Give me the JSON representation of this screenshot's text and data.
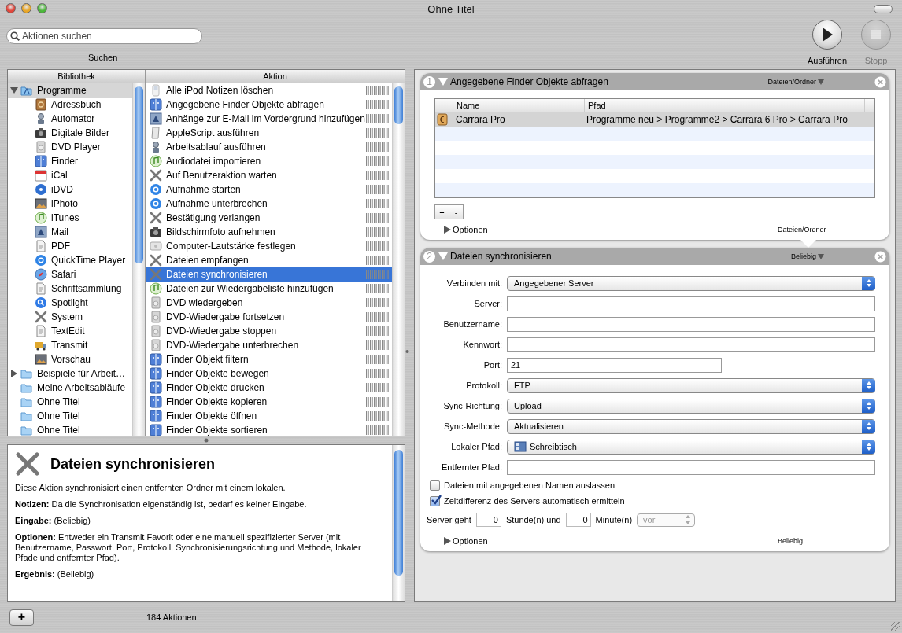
{
  "window": {
    "title": "Ohne Titel"
  },
  "toolbar": {
    "search": {
      "placeholder": "Aktionen suchen"
    },
    "search_label": "Suchen",
    "run": {
      "label": "Ausführen",
      "disabled": false
    },
    "stop": {
      "label": "Stopp",
      "disabled": true
    }
  },
  "library": {
    "header": "Bibliothek",
    "items": [
      {
        "label": "Programme",
        "kind": "apps",
        "selected": true,
        "expanded": true,
        "children": [
          {
            "label": "Adressbuch",
            "kind": "book",
            "selected": false
          },
          {
            "label": "Automator",
            "kind": "robot",
            "selected": false
          },
          {
            "label": "Digitale Bilder",
            "kind": "camera",
            "selected": false
          },
          {
            "label": "DVD Player",
            "kind": "dvd",
            "selected": false
          },
          {
            "label": "Finder",
            "kind": "finder",
            "selected": false
          },
          {
            "label": "iCal",
            "kind": "calendar",
            "selected": false
          },
          {
            "label": "iDVD",
            "kind": "disc",
            "selected": false
          },
          {
            "label": "iPhoto",
            "kind": "photo",
            "selected": false
          },
          {
            "label": "iTunes",
            "kind": "music",
            "selected": false
          },
          {
            "label": "Mail",
            "kind": "mail",
            "selected": false
          },
          {
            "label": "PDF",
            "kind": "document",
            "selected": false
          },
          {
            "label": "QuickTime Player",
            "kind": "quicktime",
            "selected": false
          },
          {
            "label": "Safari",
            "kind": "compass",
            "selected": false
          },
          {
            "label": "Schriftsammlung",
            "kind": "document",
            "selected": false
          },
          {
            "label": "Spotlight",
            "kind": "search",
            "selected": false
          },
          {
            "label": "System",
            "kind": "tools",
            "selected": false
          },
          {
            "label": "TextEdit",
            "kind": "document",
            "selected": false
          },
          {
            "label": "Transmit",
            "kind": "truck",
            "selected": false
          },
          {
            "label": "Vorschau",
            "kind": "photo",
            "selected": false
          }
        ]
      },
      {
        "label": "Beispiele für Arbeit…",
        "kind": "folder",
        "selected": false,
        "expanded": false
      },
      {
        "label": "Meine Arbeitsabläufe",
        "kind": "folder",
        "selected": false
      },
      {
        "label": "Ohne Titel",
        "kind": "folder",
        "selected": false
      },
      {
        "label": "Ohne Titel",
        "kind": "folder",
        "selected": false
      },
      {
        "label": "Ohne Titel",
        "kind": "folder",
        "selected": false
      }
    ]
  },
  "actions": {
    "header": "Aktion",
    "items": [
      {
        "label": "Alle iPod Notizen löschen",
        "kind": "ipod",
        "selected": false
      },
      {
        "label": "Angegebene Finder Objekte abfragen",
        "kind": "finder",
        "selected": false
      },
      {
        "label": "Anhänge zur E-Mail im Vordergrund hinzufügen",
        "kind": "mail",
        "selected": false
      },
      {
        "label": "AppleScript ausführen",
        "kind": "script",
        "selected": false
      },
      {
        "label": "Arbeitsablauf ausführen",
        "kind": "robot",
        "selected": false
      },
      {
        "label": "Audiodatei importieren",
        "kind": "music",
        "selected": false
      },
      {
        "label": "Auf Benutzeraktion warten",
        "kind": "tools",
        "selected": false
      },
      {
        "label": "Aufnahme starten",
        "kind": "quicktime",
        "selected": false
      },
      {
        "label": "Aufnahme unterbrechen",
        "kind": "quicktime",
        "selected": false
      },
      {
        "label": "Bestätigung verlangen",
        "kind": "tools",
        "selected": false
      },
      {
        "label": "Bildschirmfoto aufnehmen",
        "kind": "camera",
        "selected": false
      },
      {
        "label": "Computer-Lautstärke festlegen",
        "kind": "speaker",
        "selected": false
      },
      {
        "label": "Dateien empfangen",
        "kind": "tools",
        "selected": false
      },
      {
        "label": "Dateien synchronisieren",
        "kind": "tools",
        "selected": true
      },
      {
        "label": "Dateien zur Wiedergabeliste hinzufügen",
        "kind": "music",
        "selected": false
      },
      {
        "label": "DVD wiedergeben",
        "kind": "dvd",
        "selected": false
      },
      {
        "label": "DVD-Wiedergabe fortsetzen",
        "kind": "dvd",
        "selected": false
      },
      {
        "label": "DVD-Wiedergabe stoppen",
        "kind": "dvd",
        "selected": false
      },
      {
        "label": "DVD-Wiedergabe unterbrechen",
        "kind": "dvd",
        "selected": false
      },
      {
        "label": "Finder Objekt filtern",
        "kind": "finder",
        "selected": false
      },
      {
        "label": "Finder Objekte bewegen",
        "kind": "finder",
        "selected": false
      },
      {
        "label": "Finder Objekte drucken",
        "kind": "finder",
        "selected": false
      },
      {
        "label": "Finder Objekte kopieren",
        "kind": "finder",
        "selected": false
      },
      {
        "label": "Finder Objekte öffnen",
        "kind": "finder",
        "selected": false
      },
      {
        "label": "Finder Objekte sortieren",
        "kind": "finder",
        "selected": false
      }
    ]
  },
  "description": {
    "title": "Dateien synchronisieren",
    "paragraphs": [
      "Diese Aktion synchronisiert einen entfernten Ordner mit einem lokalen.",
      "**Notizen:** Da die Synchronisation eigenständig ist, bedarf es keiner Eingabe.",
      "**Eingabe:** (Beliebig)",
      "**Optionen:** Entweder ein Transmit Favorit oder eine manuell spezifizierter Server (mit Benutzername, Passwort, Port, Protokoll, Synchronisierungsrichtung und Methode, lokaler Pfade und entfernter Pfad).",
      "**Ergebnis:** (Beliebig)"
    ]
  },
  "bottom_bar": {
    "add_button": "+",
    "count": "184 Aktionen"
  },
  "workflow": [
    {
      "number": "1",
      "title": "Angegebene Finder Objekte abfragen",
      "expanded": true,
      "input_type": "Dateien/Ordner",
      "kind": "table",
      "table": {
        "columns": [
          "Name",
          "Pfad"
        ],
        "rows": [
          {
            "name": "Carrara Pro",
            "path": "Programme neu > Programme2 > Carrara 6 Pro > Carrara Pro",
            "selected": true
          }
        ],
        "buttons": [
          "+",
          "-"
        ]
      },
      "options": {
        "label": "Optionen",
        "expanded": false
      },
      "output_type": "Dateien/Ordner"
    },
    {
      "number": "2",
      "title": "Dateien synchronisieren",
      "expanded": true,
      "input_type": "Beliebig",
      "kind": "form",
      "fields": [
        {
          "kind": "popup",
          "label": "Verbinden mit:",
          "value": "Angegebener Server"
        },
        {
          "kind": "text",
          "label": "Server:"
        },
        {
          "kind": "text",
          "label": "Benutzername:"
        },
        {
          "kind": "text",
          "label": "Kennwort:"
        },
        {
          "kind": "short_text",
          "label": "Port:",
          "value": "21"
        },
        {
          "kind": "popup",
          "label": "Protokoll:",
          "value": "FTP"
        },
        {
          "kind": "popup",
          "label": "Sync-Richtung:",
          "value": "Upload"
        },
        {
          "kind": "popup",
          "label": "Sync-Methode:",
          "value": "Aktualisieren"
        },
        {
          "kind": "folder_popup",
          "label": "Lokaler Pfad:",
          "value": "Schreibtisch"
        },
        {
          "kind": "text",
          "label": "Entfernter Pfad:"
        },
        {
          "kind": "checkbox",
          "label": "Dateien mit angegebenen Namen auslassen",
          "checked": false
        },
        {
          "kind": "checkbox",
          "label": "Zeitdifferenz des Servers automatisch ermitteln",
          "checked": true
        },
        {
          "kind": "offset",
          "label": "Server geht",
          "hours": "0",
          "hours_label": "Stunde(n) und",
          "minutes": "0",
          "minutes_label": "Minute(n)",
          "direction": {
            "value": "vor",
            "disabled": true
          }
        }
      ],
      "options": {
        "label": "Optionen",
        "expanded": false
      },
      "output_type": "Beliebig"
    }
  ]
}
